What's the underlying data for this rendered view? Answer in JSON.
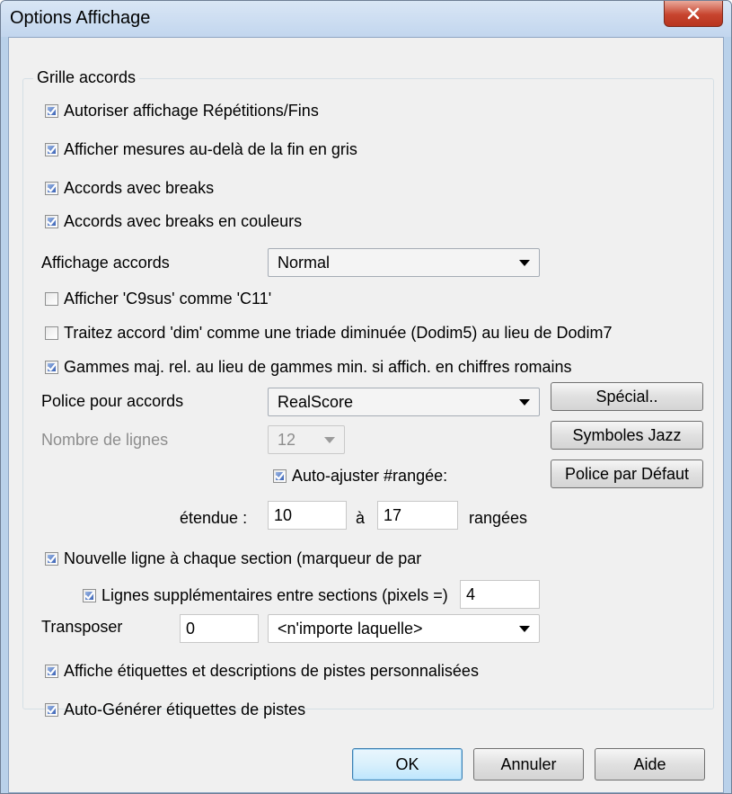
{
  "window": {
    "title": "Options Affichage"
  },
  "group": {
    "label": "Grille accords"
  },
  "checks": [
    {
      "label": "Autoriser affichage Répétitions/Fins",
      "checked": true
    },
    {
      "label": "Afficher mesures au-delà de la fin en gris",
      "checked": true
    },
    {
      "label": "Accords avec breaks",
      "checked": true
    },
    {
      "label": "Accords avec breaks en couleurs",
      "checked": true
    },
    {
      "label": "Afficher 'C9sus' comme 'C11'",
      "checked": false
    },
    {
      "label": "Traitez accord 'dim' comme une triade diminuée (Dodim5) au lieu de Dodim7",
      "checked": false
    },
    {
      "label": "Gammes maj. rel. au lieu de gammes min. si affich. en chiffres romains",
      "checked": true
    },
    {
      "label": "Auto-ajuster #rangée:",
      "checked": true
    },
    {
      "label": "Nouvelle ligne à chaque section (marqueur de par",
      "checked": true
    },
    {
      "label": "Lignes supplémentaires entre sections (pixels =)",
      "checked": true
    },
    {
      "label": "Affiche étiquettes et descriptions de pistes personnalisées",
      "checked": true
    },
    {
      "label": "Auto-Générer étiquettes de pistes",
      "checked": true
    }
  ],
  "chord_display": {
    "label": "Affichage accords",
    "value": "Normal"
  },
  "chord_font": {
    "label": "Police pour accords",
    "value": "RealScore"
  },
  "line_count": {
    "label": "Nombre de lignes",
    "value": "12"
  },
  "range": {
    "label": "étendue :",
    "from": "10",
    "to_label": "à",
    "to": "17",
    "unit": "rangées"
  },
  "extra_lines_value": "4",
  "transpose": {
    "label": "Transposer",
    "value": "0",
    "key": "<n'importe laquelle>"
  },
  "buttons": {
    "special": "Spécial..",
    "jazz": "Symboles Jazz",
    "default_font": "Police par Défaut",
    "ok": "OK",
    "cancel": "Annuler",
    "help": "Aide"
  }
}
